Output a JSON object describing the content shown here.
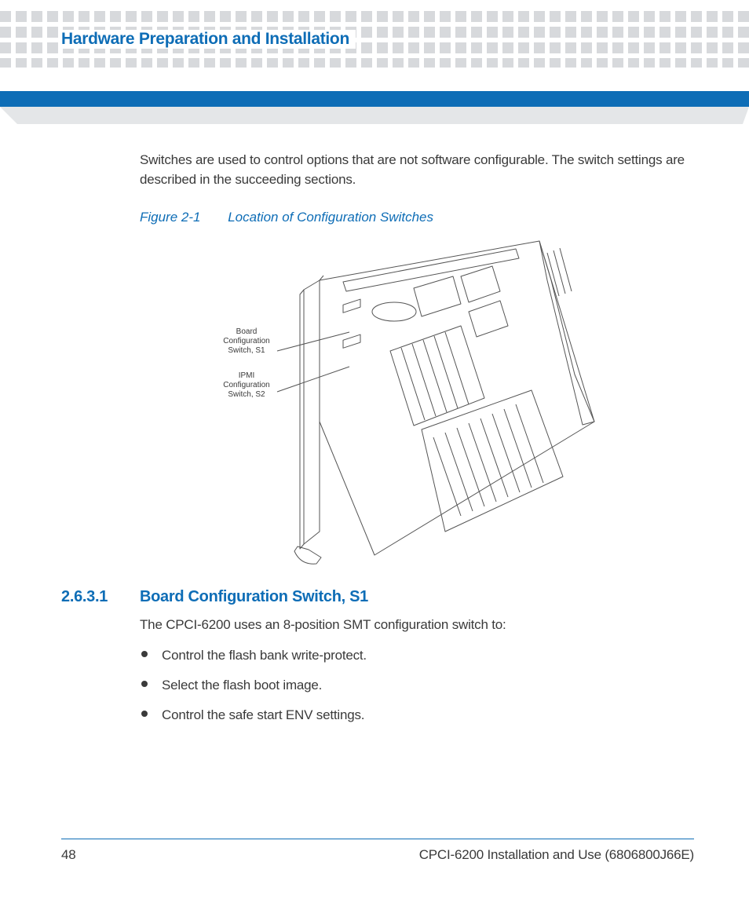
{
  "chapter_title": "Hardware Preparation and Installation",
  "intro_paragraph": "Switches are used to control options that are not software configurable. The switch settings are described in the succeeding sections.",
  "figure": {
    "number": "Figure 2-1",
    "title": "Location of Configuration Switches",
    "callouts": {
      "s1": "Board\nConfiguration\nSwitch, S1",
      "s2": "IPMI\nConfiguration\nSwitch, S2"
    }
  },
  "section": {
    "number": "2.6.3.1",
    "title": "Board Configuration Switch, S1",
    "lead": "The CPCI-6200 uses an 8-position SMT configuration switch to:",
    "bullets": [
      "Control the flash bank write-protect.",
      "Select the flash boot image.",
      "Control the safe start ENV settings."
    ]
  },
  "footer": {
    "page_number": "48",
    "doc_title": "CPCI-6200 Installation and Use (6806800J66E)"
  }
}
